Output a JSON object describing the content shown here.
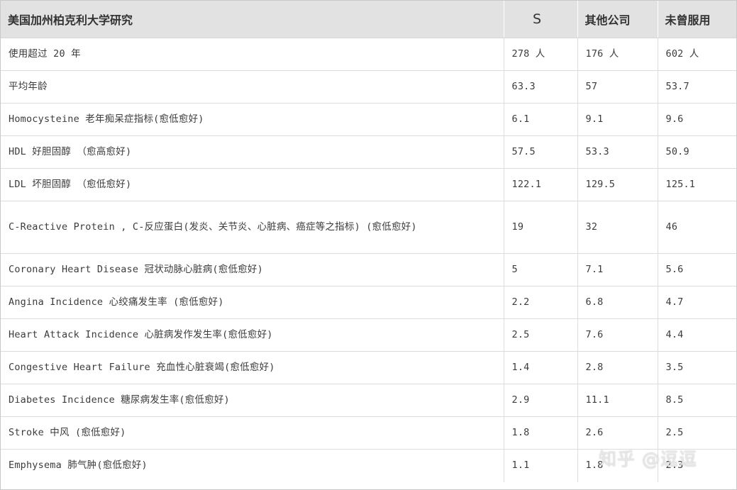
{
  "table": {
    "headers": [
      "美国加州柏克利大学研究",
      "S",
      "其他公司",
      "未曾服用"
    ],
    "rows": [
      [
        "使用超过 20 年",
        "278 人",
        "176 人",
        "602 人"
      ],
      [
        "平均年龄",
        "63.3",
        "57",
        "53.7"
      ],
      [
        "Homocysteine 老年痴呆症指标(愈低愈好)",
        "6.1",
        "9.1",
        "9.6"
      ],
      [
        "HDL 好胆固醇 （愈高愈好)",
        "57.5",
        "53.3",
        "50.9"
      ],
      [
        "LDL 坏胆固醇 （愈低愈好)",
        "122.1",
        "129.5",
        "125.1"
      ],
      [
        "C-Reactive Protein , C-反应蛋白(发炎、关节炎、心脏病、癌症等之指标) (愈低愈好)",
        "19",
        "32",
        "46"
      ],
      [
        "Coronary Heart Disease 冠状动脉心脏病(愈低愈好)",
        "5",
        "7.1",
        "5.6"
      ],
      [
        "Angina Incidence 心绞痛发生率 (愈低愈好)",
        "2.2",
        "6.8",
        "4.7"
      ],
      [
        "Heart Attack Incidence 心脏病发作发生率(愈低愈好)",
        "2.5",
        "7.6",
        "4.4"
      ],
      [
        "Congestive Heart Failure 充血性心脏衰竭(愈低愈好)",
        "1.4",
        "2.8",
        "3.5"
      ],
      [
        "Diabetes Incidence 糖尿病发生率(愈低愈好)",
        "2.9",
        "11.1",
        "8.5"
      ],
      [
        "Stroke 中风 (愈低愈好)",
        "1.8",
        "2.6",
        "2.5"
      ],
      [
        "Emphysema 肺气肿(愈低愈好)",
        "1.1",
        "1.8",
        "2.3"
      ]
    ]
  },
  "watermark": "知乎 @逗逗"
}
